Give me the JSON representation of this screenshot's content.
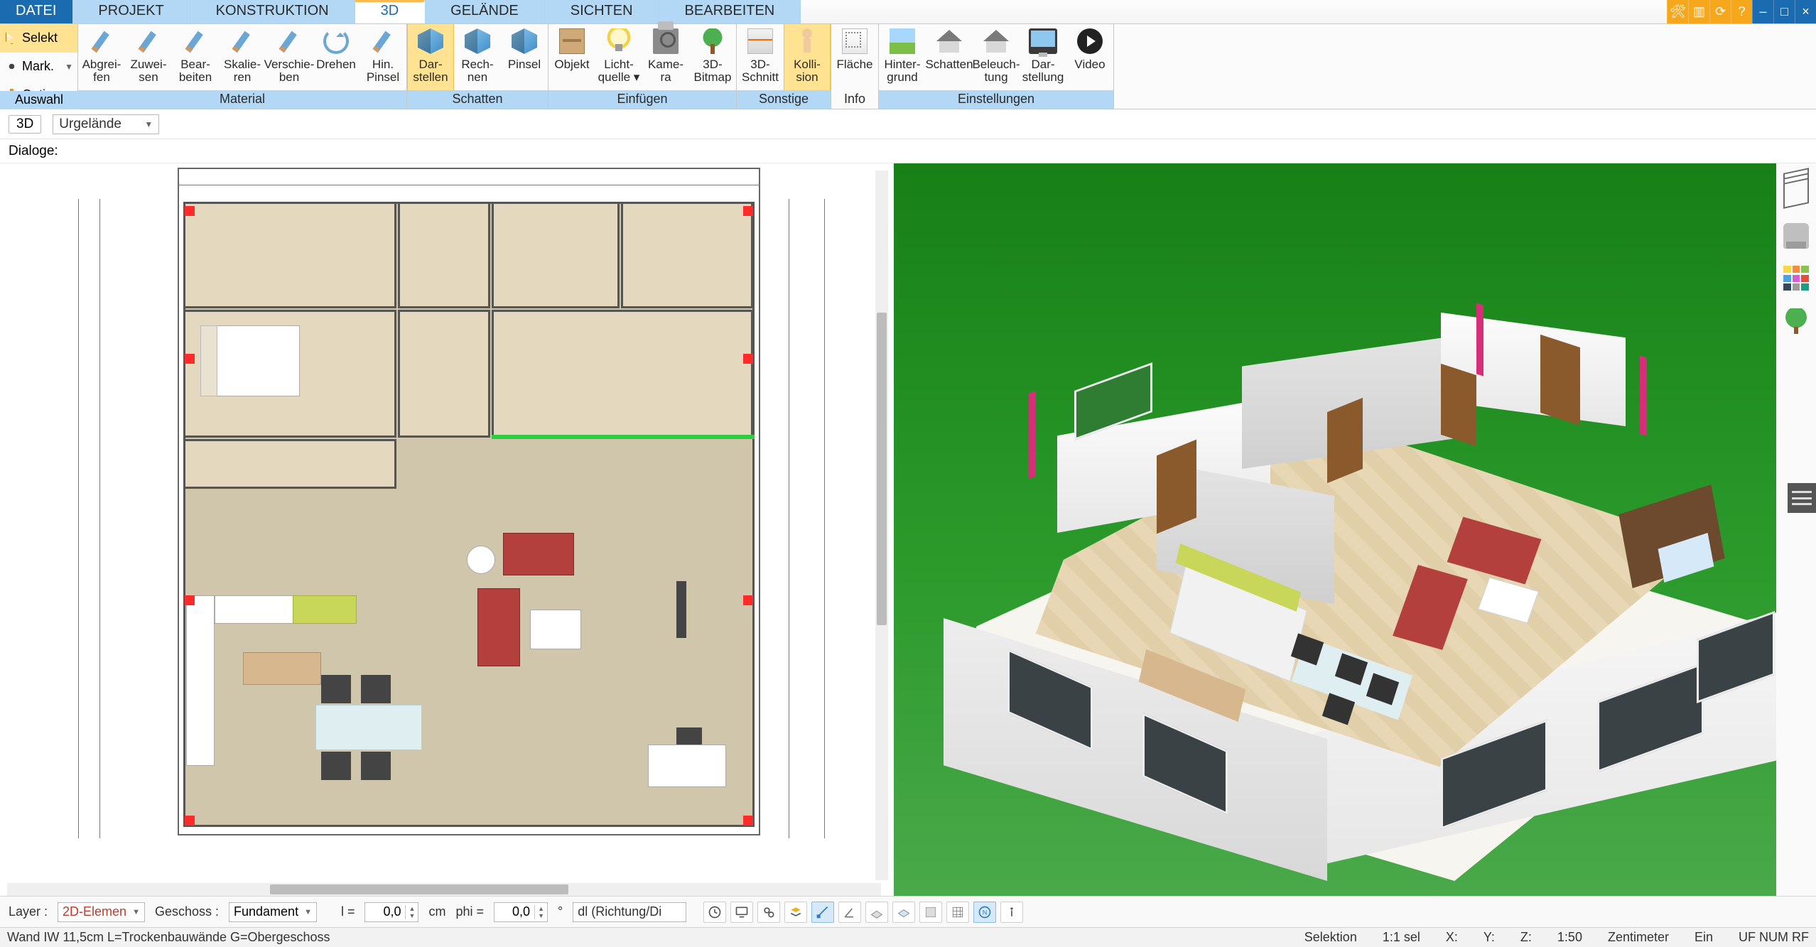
{
  "menu": {
    "items": [
      "DATEI",
      "PROJEKT",
      "KONSTRUKTION",
      "3D",
      "GELÄNDE",
      "SICHTEN",
      "BEARBEITEN"
    ],
    "active_index": 3
  },
  "leftbox": {
    "select": "Selekt",
    "mark": "Mark.",
    "options": "Optionen"
  },
  "ribbon_groups": [
    {
      "label": "Auswahl",
      "blue": true,
      "buttons": []
    },
    {
      "label": "Material",
      "blue": true,
      "buttons": [
        {
          "key": "abgreifen",
          "l1": "Abgrei-",
          "l2": "fen",
          "icon": "brush"
        },
        {
          "key": "zuweisen",
          "l1": "Zuwei-",
          "l2": "sen",
          "icon": "brush"
        },
        {
          "key": "bearbeiten",
          "l1": "Bear-",
          "l2": "beiten",
          "icon": "brush"
        },
        {
          "key": "skalieren",
          "l1": "Skalie-",
          "l2": "ren",
          "icon": "brush"
        },
        {
          "key": "verschieben",
          "l1": "Verschie-",
          "l2": "ben",
          "icon": "brush"
        },
        {
          "key": "drehen",
          "l1": "Drehen",
          "l2": "",
          "icon": "rot"
        },
        {
          "key": "hinpinsel",
          "l1": "Hin.",
          "l2": "Pinsel",
          "icon": "brush"
        }
      ]
    },
    {
      "label": "Schatten",
      "blue": true,
      "buttons": [
        {
          "key": "darstellen",
          "l1": "Dar-",
          "l2": "stellen",
          "icon": "cube",
          "active": true
        },
        {
          "key": "rechnen",
          "l1": "Rech-",
          "l2": "nen",
          "icon": "cube"
        },
        {
          "key": "pinsel",
          "l1": "Pinsel",
          "l2": "",
          "icon": "cube"
        }
      ]
    },
    {
      "label": "Einfügen",
      "blue": true,
      "buttons": [
        {
          "key": "objekt",
          "l1": "Objekt",
          "l2": "",
          "icon": "obj"
        },
        {
          "key": "lichtquelle",
          "l1": "Licht-",
          "l2": "quelle ▾",
          "icon": "bulb"
        },
        {
          "key": "kamera",
          "l1": "Kame-",
          "l2": "ra",
          "icon": "cam"
        },
        {
          "key": "bitmap",
          "l1": "3D-",
          "l2": "Bitmap",
          "icon": "tree"
        }
      ]
    },
    {
      "label": "Sonstige",
      "blue": true,
      "buttons": [
        {
          "key": "schnitt",
          "l1": "3D-",
          "l2": "Schnitt",
          "icon": "cut"
        },
        {
          "key": "kollision",
          "l1": "Kolli-",
          "l2": "sion",
          "icon": "man",
          "active": true
        }
      ]
    },
    {
      "label": "Info",
      "blue": false,
      "buttons": [
        {
          "key": "flaeche",
          "l1": "Fläche",
          "l2": "",
          "icon": "area"
        }
      ]
    },
    {
      "label": "Einstellungen",
      "blue": true,
      "buttons": [
        {
          "key": "hintergrund",
          "l1": "Hinter-",
          "l2": "grund",
          "icon": "sky"
        },
        {
          "key": "schatten2",
          "l1": "Schatten",
          "l2": "",
          "icon": "house"
        },
        {
          "key": "beleuchtung",
          "l1": "Beleuch-",
          "l2": "tung",
          "icon": "house"
        },
        {
          "key": "darstellung",
          "l1": "Dar-",
          "l2": "stellung",
          "icon": "monitor"
        },
        {
          "key": "video",
          "l1": "Video",
          "l2": "",
          "icon": "play"
        }
      ]
    }
  ],
  "subbar": {
    "chip": "3D",
    "combo": "Urgelände"
  },
  "dialog_label": "Dialoge:",
  "bottom": {
    "layer_label": "Layer :",
    "layer_value": "2D-Elemen",
    "floor_label": "Geschoss :",
    "floor_value": "Fundament",
    "l_eq": "l =",
    "l_val": "0,0",
    "unit": "cm",
    "phi_eq": "phi =",
    "phi_val": "0,0",
    "deg": "°",
    "dir": "dl (Richtung/Di"
  },
  "status": {
    "left": "Wand IW 11,5cm L=Trockenbauwände G=Obergeschoss",
    "selection": "Selektion",
    "scale_sel": "1:1 sel",
    "x": "X:",
    "y": "Y:",
    "z": "Z:",
    "scale": "1:50",
    "unit": "Zentimeter",
    "ein": "Ein",
    "flags": "UF NUM RF"
  },
  "side_palette": [
    "#f8d648",
    "#f58b3c",
    "#8bc34a",
    "#4aa3df",
    "#d85bd8",
    "#e74c3c",
    "#34495e",
    "#9b9b9b",
    "#16a085"
  ]
}
